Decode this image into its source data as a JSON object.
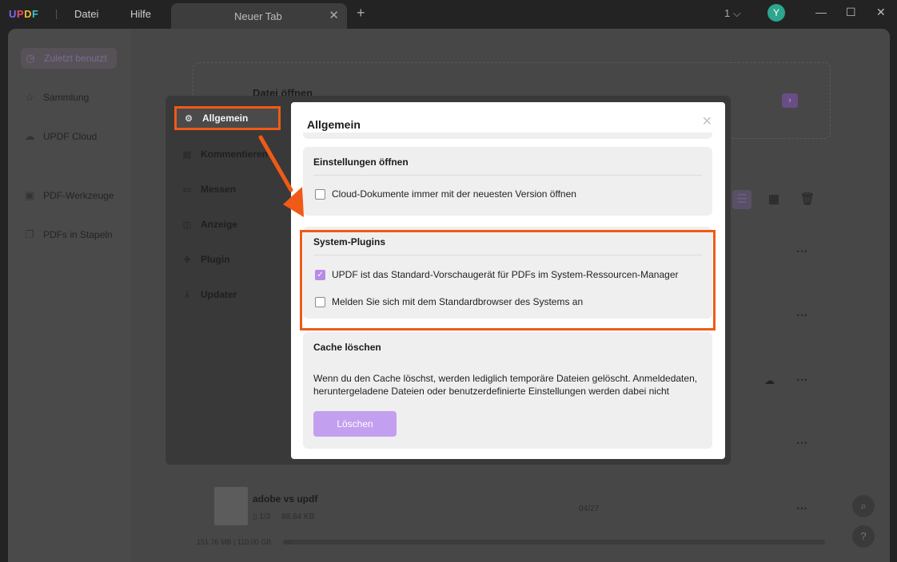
{
  "titlebar": {
    "logo": "UPDF",
    "menu": [
      "Datei",
      "Hilfe"
    ],
    "tab_label": "Neuer Tab",
    "page_indicator": "1",
    "avatar_initial": "Y"
  },
  "sidebar": {
    "items": [
      {
        "label": "Zuletzt benutzt",
        "icon": "clock-icon"
      },
      {
        "label": "Sammlung",
        "icon": "star-icon"
      },
      {
        "label": "UPDF Cloud",
        "icon": "cloud-icon"
      },
      {
        "label": "PDF-Werkzeuge",
        "icon": "toolbox-icon"
      },
      {
        "label": "PDFs in Stapeln",
        "icon": "stack-icon"
      }
    ]
  },
  "main": {
    "open_file": "Datei öffnen",
    "recent_file": {
      "name": "adobe vs updf",
      "pages": "1/3",
      "size": "88.84 KB",
      "date": "04/27"
    },
    "storage": "151.76 MB | 110.00 GB"
  },
  "dialog": {
    "nav": [
      {
        "label": "Allgemein",
        "icon": "gear-icon"
      },
      {
        "label": "Kommentieren",
        "icon": "comment-icon"
      },
      {
        "label": "Messen",
        "icon": "ruler-icon"
      },
      {
        "label": "Anzeige",
        "icon": "display-icon"
      },
      {
        "label": "Plugin",
        "icon": "puzzle-icon"
      },
      {
        "label": "Updater",
        "icon": "download-icon"
      }
    ],
    "title": "Allgemein",
    "sections": {
      "open_settings": {
        "title": "Einstellungen öffnen",
        "options": [
          {
            "label": "Cloud-Dokumente immer mit der neuesten Version öffnen",
            "checked": false
          }
        ]
      },
      "system_plugins": {
        "title": "System-Plugins",
        "options": [
          {
            "label": "UPDF ist das Standard-Vorschaugerät für PDFs im System-Ressourcen-Manager",
            "checked": true
          },
          {
            "label": "Melden Sie sich mit dem Standardbrowser des Systems an",
            "checked": false
          }
        ]
      },
      "cache": {
        "title": "Cache löschen",
        "text": "Wenn du den Cache löschst, werden lediglich temporäre Dateien gelöscht. Anmeldedaten, heruntergeladene Dateien oder benutzerdefinierte Einstellungen werden dabei nicht",
        "button": "Löschen"
      }
    }
  },
  "colors": {
    "accent": "#b68ce6",
    "highlight": "#f05a16"
  }
}
